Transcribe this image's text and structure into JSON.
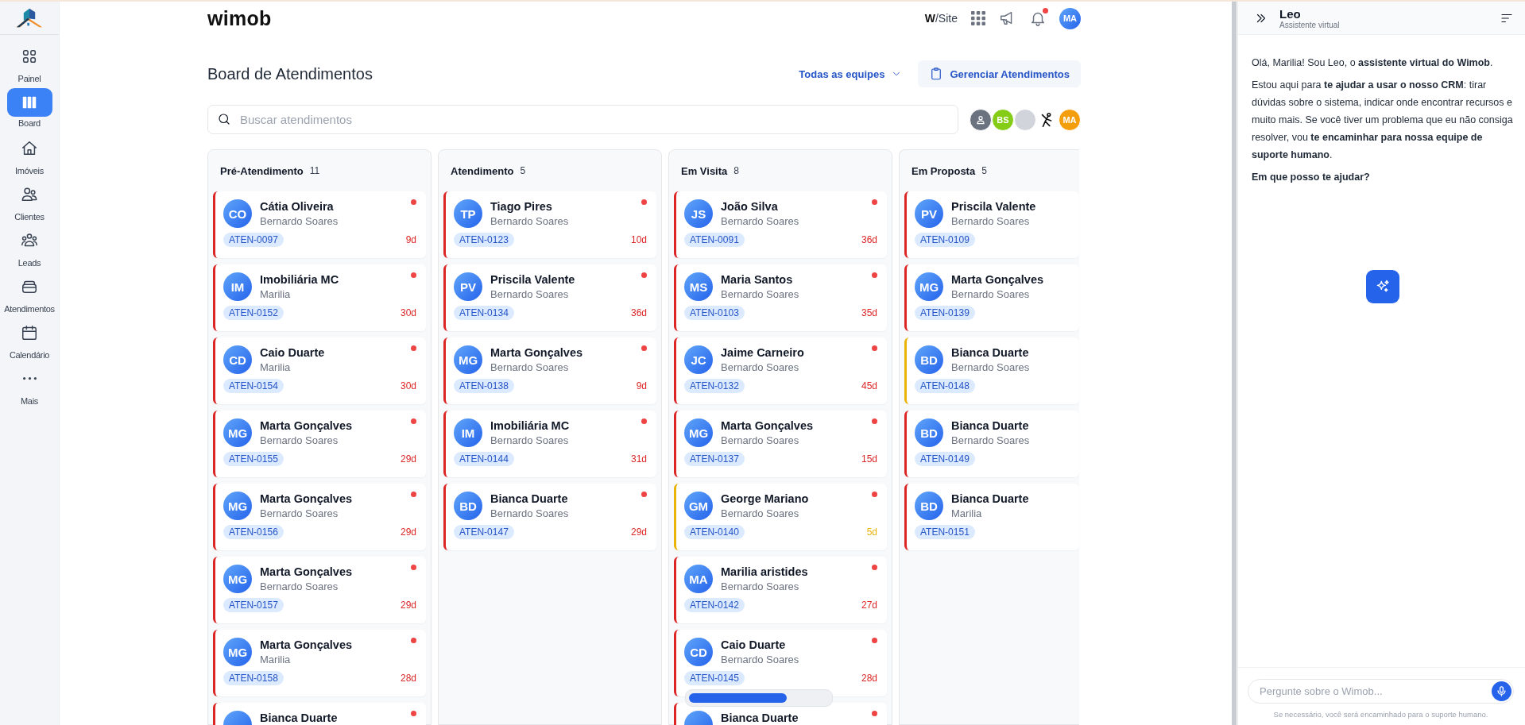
{
  "sidebar": {
    "items": [
      {
        "label": "Painel",
        "selected": false
      },
      {
        "label": "Board",
        "selected": true
      },
      {
        "label": "Imóveis",
        "selected": false
      },
      {
        "label": "Clientes",
        "selected": false
      },
      {
        "label": "Leads",
        "selected": false
      },
      {
        "label": "Atendimentos",
        "selected": false
      },
      {
        "label": "Calendário",
        "selected": false
      },
      {
        "label": "Mais",
        "selected": false
      }
    ]
  },
  "header": {
    "logo": "wimob",
    "site_link": {
      "prefix": "W",
      "suffix": "/Site"
    },
    "notification_badge": true,
    "user_initials": "MA"
  },
  "page": {
    "title": "Board de Atendimentos",
    "team_filter": "Todas as equipes",
    "manage_button": "Gerenciar Atendimentos"
  },
  "search": {
    "placeholder": "Buscar atendimentos"
  },
  "team_avatars": [
    {
      "kind": "icon",
      "color": "#6b7280"
    },
    {
      "kind": "initials",
      "initials": "BS",
      "color": "#84cc16"
    },
    {
      "kind": "photo",
      "color": "#d1d5db"
    },
    {
      "kind": "figure",
      "color": "#ffffff"
    },
    {
      "kind": "initials",
      "initials": "MA",
      "color": "#f59e0b"
    }
  ],
  "columns": [
    {
      "title": "Pré-Atendimento",
      "count": "11",
      "cards": [
        {
          "initials": "CO",
          "name": "Cátia Oliveira",
          "agent": "Bernardo Soares",
          "code": "ATEN-0097",
          "days": "9d",
          "alert": true,
          "color": "#dc2626"
        },
        {
          "initials": "IM",
          "name": "Imobiliária MC",
          "agent": "Marilia",
          "code": "ATEN-0152",
          "days": "30d",
          "alert": true,
          "color": "#dc2626"
        },
        {
          "initials": "CD",
          "name": "Caio Duarte",
          "agent": "Marilia",
          "code": "ATEN-0154",
          "days": "30d",
          "alert": true,
          "color": "#dc2626"
        },
        {
          "initials": "MG",
          "name": "Marta Gonçalves",
          "agent": "Bernardo Soares",
          "code": "ATEN-0155",
          "days": "29d",
          "alert": true,
          "color": "#dc2626"
        },
        {
          "initials": "MG",
          "name": "Marta Gonçalves",
          "agent": "Bernardo Soares",
          "code": "ATEN-0156",
          "days": "29d",
          "alert": true,
          "color": "#dc2626"
        },
        {
          "initials": "MG",
          "name": "Marta Gonçalves",
          "agent": "Bernardo Soares",
          "code": "ATEN-0157",
          "days": "29d",
          "alert": true,
          "color": "#dc2626"
        },
        {
          "initials": "MG",
          "name": "Marta Gonçalves",
          "agent": "Marilia",
          "code": "ATEN-0158",
          "days": "28d",
          "alert": true,
          "color": "#dc2626"
        },
        {
          "name": "Bianca Duarte",
          "alert": true,
          "color": "#dc2626"
        }
      ]
    },
    {
      "title": "Atendimento",
      "count": "5",
      "cards": [
        {
          "initials": "TP",
          "name": "Tiago Pires",
          "agent": "Bernardo Soares",
          "code": "ATEN-0123",
          "days": "10d",
          "alert": true,
          "color": "#dc2626"
        },
        {
          "initials": "PV",
          "name": "Priscila Valente",
          "agent": "Bernardo Soares",
          "code": "ATEN-0134",
          "days": "36d",
          "alert": true,
          "color": "#dc2626"
        },
        {
          "initials": "MG",
          "name": "Marta Gonçalves",
          "agent": "Bernardo Soares",
          "code": "ATEN-0138",
          "days": "9d",
          "alert": true,
          "color": "#dc2626"
        },
        {
          "initials": "IM",
          "name": "Imobiliária MC",
          "agent": "Bernardo Soares",
          "code": "ATEN-0144",
          "days": "31d",
          "alert": true,
          "color": "#dc2626"
        },
        {
          "initials": "BD",
          "name": "Bianca Duarte",
          "agent": "Bernardo Soares",
          "code": "ATEN-0147",
          "days": "29d",
          "alert": true,
          "color": "#dc2626"
        }
      ]
    },
    {
      "title": "Em Visita",
      "count": "8",
      "cards": [
        {
          "initials": "JS",
          "name": "João Silva",
          "agent": "Bernardo Soares",
          "code": "ATEN-0091",
          "days": "36d",
          "alert": true,
          "color": "#dc2626"
        },
        {
          "initials": "MS",
          "name": "Maria Santos",
          "agent": "Bernardo Soares",
          "code": "ATEN-0103",
          "days": "35d",
          "alert": true,
          "color": "#dc2626"
        },
        {
          "initials": "JC",
          "name": "Jaime Carneiro",
          "agent": "Bernardo Soares",
          "code": "ATEN-0132",
          "days": "45d",
          "alert": true,
          "color": "#dc2626"
        },
        {
          "initials": "MG",
          "name": "Marta Gonçalves",
          "agent": "Bernardo Soares",
          "code": "ATEN-0137",
          "days": "15d",
          "alert": true,
          "color": "#dc2626"
        },
        {
          "initials": "GM",
          "name": "George Mariano",
          "agent": "Bernardo Soares",
          "code": "ATEN-0140",
          "days": "5d",
          "alert": true,
          "color": "#eab308"
        },
        {
          "initials": "MA",
          "name": "Marilia aristides",
          "agent": "Bernardo Soares",
          "code": "ATEN-0142",
          "days": "27d",
          "alert": true,
          "color": "#dc2626"
        },
        {
          "initials": "CD",
          "name": "Caio Duarte",
          "agent": "Bernardo Soares",
          "code": "ATEN-0145",
          "days": "28d",
          "alert": true,
          "color": "#dc2626"
        },
        {
          "name": "Bianca Duarte",
          "alert": true,
          "color": "#dc2626"
        }
      ]
    },
    {
      "title": "Em Proposta",
      "count": "5",
      "cards": [
        {
          "initials": "PV",
          "name": "Priscila Valente",
          "agent": "Bernardo Soares",
          "code": "ATEN-0109",
          "alert": false,
          "color": "#dc2626"
        },
        {
          "initials": "MG",
          "name": "Marta Gonçalves",
          "agent": "Bernardo Soares",
          "code": "ATEN-0139",
          "alert": false,
          "color": "#dc2626"
        },
        {
          "initials": "BD",
          "name": "Bianca Duarte",
          "agent": "Bernardo Soares",
          "code": "ATEN-0148",
          "alert": false,
          "color": "#eab308"
        },
        {
          "initials": "BD",
          "name": "Bianca Duarte",
          "agent": "Bernardo Soares",
          "code": "ATEN-0149",
          "alert": false,
          "color": "#dc2626"
        },
        {
          "initials": "BD",
          "name": "Bianca Duarte",
          "agent": "Marilia",
          "code": "ATEN-0151",
          "alert": false,
          "color": "#dc2626"
        }
      ]
    }
  ],
  "loading_bar": {
    "level": 0.7
  },
  "assistant": {
    "name": "Leo",
    "subtitle": "Assistente virtual",
    "messages": [
      "Olá, Marilia! Sou Leo, o **assistente virtual do Wimob**.",
      "Estou aqui para **te ajudar a usar o nosso CRM**: tirar dúvidas sobre o sistema, indicar onde encontrar recursos e muito mais. Se você tiver um problema que eu não consiga resolver, vou **te encaminhar para nossa equipe de suporte humano**.",
      "**Em que posso te ajudar?**"
    ],
    "input": {
      "placeholder": "Pergunte sobre o Wimob..."
    },
    "footnote": "Se necessário, você será encaminhado para o suporte humano."
  }
}
